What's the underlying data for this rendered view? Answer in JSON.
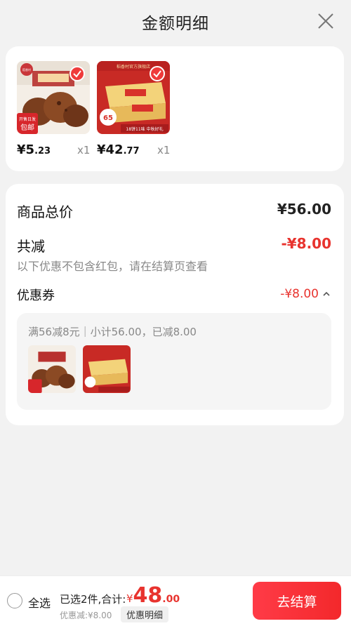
{
  "header": {
    "title": "金额明细"
  },
  "products": [
    {
      "price_int": "¥5",
      "price_dec": ".23",
      "qty": "x1",
      "badge_top": "开售日发",
      "badge_bottom": "包邮",
      "brand": "稻香村"
    },
    {
      "price_int": "¥42",
      "price_dec": ".77",
      "qty": "x1",
      "banner": "稻香村官方旗舰店",
      "tag": "65",
      "strip": "18饼11味 中秋好礼"
    }
  ],
  "summary": {
    "total_label": "商品总价",
    "total_value": "¥56.00",
    "reduce_label": "共减",
    "reduce_value": "-¥8.00",
    "note": "以下优惠不包含红包，请在结算页查看",
    "coupon_label": "优惠券",
    "coupon_value": "-¥8.00",
    "coupon_desc": "满56减8元｜小计56.00，已减8.00"
  },
  "bottom": {
    "select_all": "全选",
    "selected": "已选2件,合计:",
    "currency": "¥",
    "amount_int": "48",
    "amount_dec": ".00",
    "discount": "优惠减:¥8.00",
    "detail_btn": "优惠明细",
    "checkout": "去结算"
  },
  "colors": {
    "accent": "#e8332e",
    "checkout": "#f3282b"
  }
}
